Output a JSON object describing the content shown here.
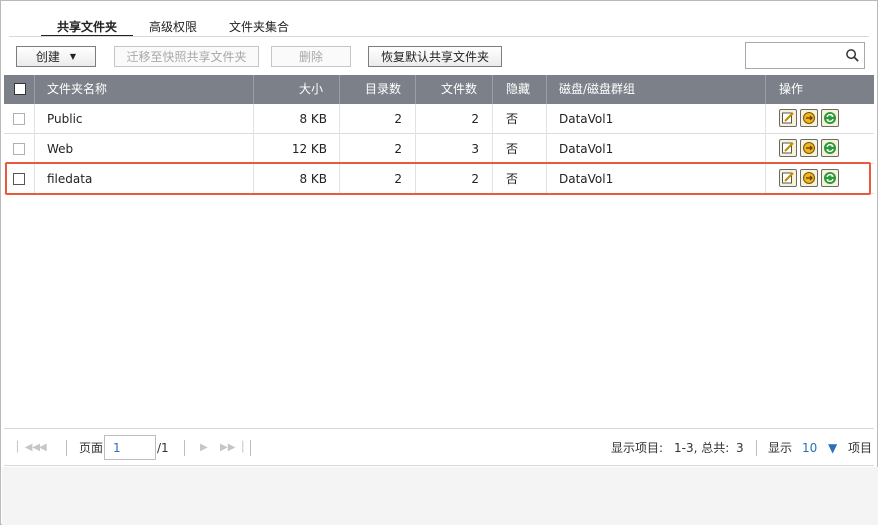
{
  "tabs": [
    {
      "label": "共享文件夹",
      "active": true
    },
    {
      "label": "高级权限",
      "active": false
    },
    {
      "label": "文件夹集合",
      "active": false
    }
  ],
  "toolbar": {
    "create_label": "创建",
    "migrate_label": "迁移至快照共享文件夹",
    "delete_label": "删除",
    "restore_label": "恢复默认共享文件夹"
  },
  "search": {
    "placeholder": "",
    "icon": "search-icon"
  },
  "table": {
    "headers": {
      "name": "文件夹名称",
      "size": "大小",
      "dirs": "目录数",
      "files": "文件数",
      "hidden": "隐藏",
      "volume": "磁盘/磁盘群组",
      "action": "操作"
    },
    "rows": [
      {
        "name": "Public",
        "size": "8 KB",
        "dirs": "2",
        "files": "2",
        "hidden": "否",
        "volume": "DataVol1"
      },
      {
        "name": "Web",
        "size": "12 KB",
        "dirs": "2",
        "files": "3",
        "hidden": "否",
        "volume": "DataVol1"
      },
      {
        "name": "filedata",
        "size": "8 KB",
        "dirs": "2",
        "files": "2",
        "hidden": "否",
        "volume": "DataVol1"
      }
    ]
  },
  "pager": {
    "page_label": "页面",
    "page_value": "1",
    "page_total": "/1",
    "display_label": "显示项目:",
    "range": "1-3, 总共:",
    "total": "3",
    "show_label": "显示",
    "per_page": "10",
    "items_label": "项目"
  },
  "colors": {
    "header_bg": "#7c8089",
    "highlight": "#e85a3c",
    "link_blue": "#2a6fb8"
  }
}
